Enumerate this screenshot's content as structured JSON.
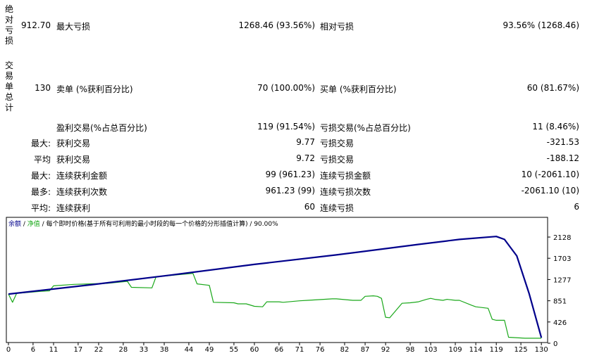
{
  "report": {
    "drawdown": {
      "side_label": "绝对亏损",
      "absolute_value": "912.70",
      "max_label": "最大亏损",
      "max_value": "1268.46 (93.56%)",
      "relative_label": "相对亏损",
      "relative_value": "93.56% (1268.46)"
    },
    "trades": {
      "side_label": "交易单总计",
      "total": "130",
      "short_label": "卖单 (%获利百分比)",
      "short_value": "70 (100.00%)",
      "long_label": "买单 (%获利百分比)",
      "long_value": "60 (81.67%)",
      "profit_label": "盈利交易(%占总百分比)",
      "profit_value": "119 (91.54%)",
      "loss_label": "亏损交易(%占总百分比)",
      "loss_value": "11 (8.46%)"
    },
    "rows": [
      {
        "prefix": "最大:",
        "left_label": "获利交易",
        "left_value": "9.77",
        "right_label": "亏损交易",
        "right_value": "-321.53"
      },
      {
        "prefix": "平均",
        "left_label": "获利交易",
        "left_value": "9.72",
        "right_label": "亏损交易",
        "right_value": "-188.12"
      },
      {
        "prefix": "最大:",
        "left_label": "连续获利金额",
        "left_value": "99 (961.23)",
        "right_label": "连续亏损金额",
        "right_value": "10 (-2061.10)"
      },
      {
        "prefix": "最多:",
        "left_label": "连续获利次数",
        "left_value": "961.23 (99)",
        "right_label": "连续亏损次数",
        "right_value": "-2061.10 (10)"
      },
      {
        "prefix": "平均:",
        "left_label": "连续获利",
        "left_value": "60",
        "right_label": "连续亏损",
        "right_value": "6"
      }
    ]
  },
  "chart_data": {
    "type": "line",
    "legend": {
      "balance": "余额",
      "sep1": " / ",
      "equity": "净值",
      "rest": " / 每个即时价格(基于所有可利用的最小时段的每一个价格的分形插值计算) / 90.00%"
    },
    "x_ticks": [
      0,
      6,
      11,
      17,
      22,
      28,
      33,
      38,
      44,
      49,
      55,
      60,
      66,
      71,
      76,
      82,
      87,
      92,
      98,
      103,
      109,
      114,
      119,
      125,
      130
    ],
    "y_ticks": [
      0,
      426,
      851,
      1277,
      1703,
      2128
    ],
    "xlim": [
      0,
      131
    ],
    "ylim": [
      0,
      2340
    ],
    "grid": false,
    "series": [
      {
        "name": "余额",
        "color": "#00008b",
        "x": [
          0,
          20,
          40,
          60,
          80,
          100,
          110,
          119,
          121,
          124,
          127,
          130
        ],
        "y": [
          985,
          1170,
          1370,
          1580,
          1770,
          1980,
          2080,
          2140,
          2080,
          1750,
          1000,
          110
        ]
      },
      {
        "name": "净值",
        "color": "#1aa81a",
        "x": [
          0,
          1,
          2,
          8,
          10,
          11,
          16,
          24,
          29,
          30,
          35,
          36,
          45,
          46,
          49,
          50,
          55,
          56,
          58,
          60,
          62,
          63,
          66,
          67,
          71,
          73,
          79,
          80,
          84,
          86,
          87,
          89,
          90,
          91,
          92,
          93,
          96,
          98,
          100,
          102,
          103,
          104,
          106,
          107,
          109,
          110,
          113,
          114,
          117,
          118,
          119,
          121,
          122,
          126,
          130
        ],
        "y": [
          985,
          820,
          1000,
          1040,
          1050,
          1150,
          1180,
          1200,
          1240,
          1120,
          1110,
          1330,
          1400,
          1190,
          1160,
          820,
          810,
          790,
          790,
          740,
          730,
          830,
          830,
          820,
          850,
          860,
          890,
          890,
          860,
          860,
          940,
          950,
          940,
          900,
          520,
          510,
          800,
          810,
          830,
          880,
          900,
          880,
          860,
          880,
          860,
          860,
          760,
          730,
          700,
          480,
          460,
          460,
          120,
          100,
          100
        ]
      }
    ]
  }
}
